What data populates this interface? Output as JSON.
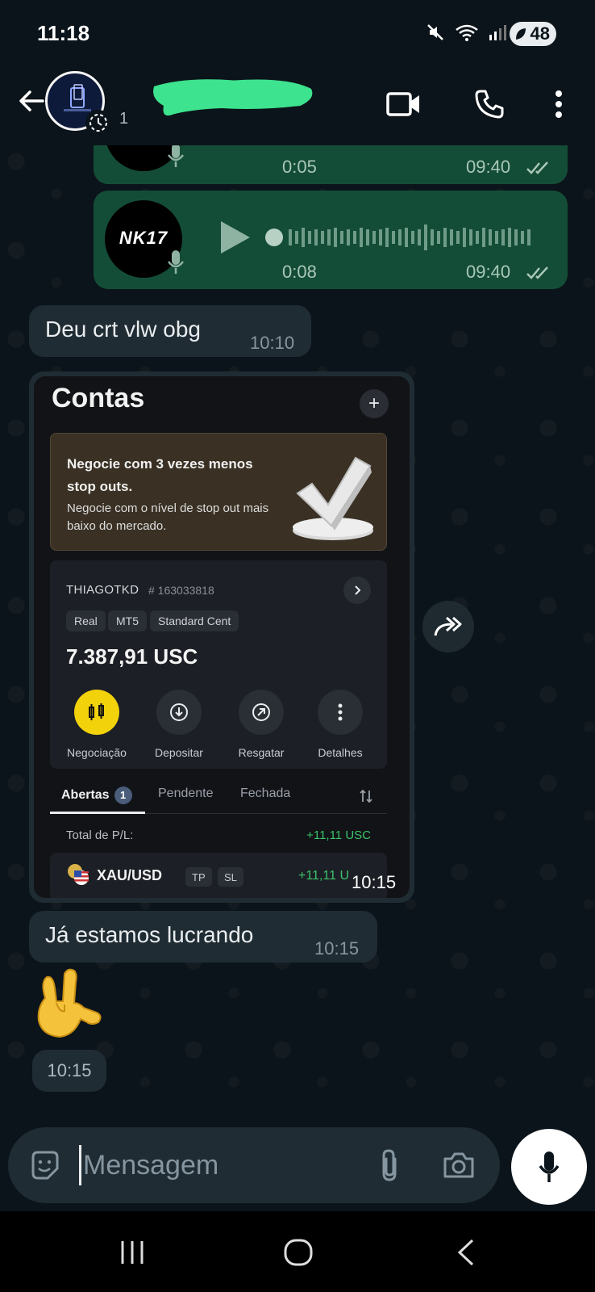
{
  "status_bar": {
    "time": "11:18",
    "battery": "48"
  },
  "header": {
    "contact_sub": "1"
  },
  "messages": {
    "audio1": {
      "duration": "0:05",
      "time": "09:40"
    },
    "audio2": {
      "duration": "0:08",
      "time": "09:40",
      "avatar_text": "NK17"
    },
    "text1": {
      "text": "Deu crt vlw obg",
      "time": "10:10"
    },
    "image": {
      "time": "10:15",
      "title": "Contas",
      "plus": "+",
      "promo_heading": "Negocie com 3 vezes menos stop outs.",
      "promo_sub": "Negocie com o nível de stop out mais baixo do mercado.",
      "account_name": "THIAGOTKD",
      "account_id": "# 163033818",
      "chips": [
        "Real",
        "MT5",
        "Standard Cent"
      ],
      "balance": "7.387,91 USC",
      "actions": [
        "Negociação",
        "Depositar",
        "Resgatar",
        "Detalhes"
      ],
      "tabs": [
        "Abertas",
        "Pendente",
        "Fechada"
      ],
      "open_count": "1",
      "pl_label": "Total de P/L:",
      "pl_value": "+11,11 USC",
      "position_symbol": "XAU/USD",
      "position_chips": [
        "TP",
        "SL"
      ],
      "position_value": "+11,11 U"
    },
    "text2": {
      "text": "Já estamos lucrando",
      "time": "10:15"
    },
    "emoji": {
      "time": "10:15"
    }
  },
  "composer": {
    "placeholder": "Mensagem"
  },
  "colors": {
    "background": "#0b141a",
    "outgoing_bubble": "#144d37",
    "incoming_bubble": "#202c33",
    "profit_green": "#3cc36a",
    "redaction": "#3de38e"
  },
  "icons": [
    "back-arrow-icon",
    "video-call-icon",
    "phone-icon",
    "more-options-icon",
    "mic-icon",
    "play-icon",
    "double-check-icon",
    "forward-icon",
    "sticker-icon",
    "attach-icon",
    "camera-icon",
    "recents-icon",
    "home-icon",
    "nav-back-icon"
  ]
}
